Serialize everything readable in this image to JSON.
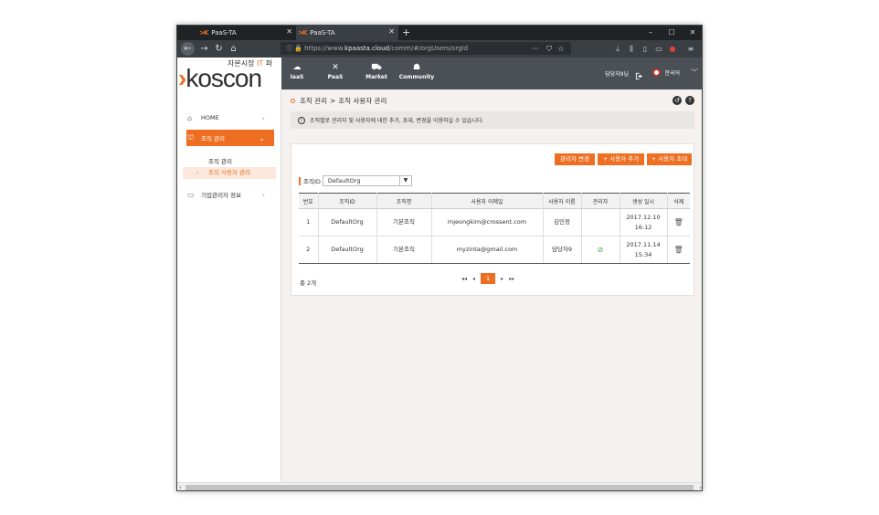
{
  "browser": {
    "tabs": [
      {
        "label": "PaaS-TA",
        "logo": ">K"
      },
      {
        "label": "PaaS-TA",
        "logo": ">K"
      }
    ],
    "new_tab": "+",
    "controls": {
      "minimize": "–",
      "maximize": "☐",
      "close": "✕"
    },
    "url_prefix": "https://www.",
    "url_domain": "kpaasta.cloud",
    "url_path": "/comm/#/orgUsers/orgId",
    "url_more": "···"
  },
  "app": {
    "logo_tagline": "자본시장 ",
    "logo_tagline_it": "IT",
    "logo_tagline_rest": " 파",
    "logo_word": "koscon",
    "logo_chevron": "›",
    "menu": [
      {
        "label": "IaaS",
        "icon": "cloud-icon"
      },
      {
        "label": "PaaS",
        "icon": "tools-icon"
      },
      {
        "label": "Market",
        "icon": "cart-icon"
      },
      {
        "label": "Community",
        "icon": "chat-icon"
      }
    ],
    "user": "담당자9님",
    "language": "한국어"
  },
  "sidebar": {
    "items": [
      {
        "label": "HOME",
        "icon": "home-icon"
      },
      {
        "label": "조직 관리",
        "icon": "org-icon"
      },
      {
        "label": "기업관리자 정보",
        "icon": "card-icon"
      }
    ],
    "subitems": [
      {
        "label": "조직 관리"
      },
      {
        "label": "조직 사용자 관리"
      }
    ]
  },
  "main": {
    "breadcrumb_parent": "조직 관리",
    "breadcrumb_sep": ">",
    "breadcrumb_current": "조직 사용자 관리",
    "notice": "조직별로 관리자 및 사용자에 대한 추가, 초대, 변경을 이용하실 수 있습니다.",
    "buttons": {
      "admin_change": "관리자 변경",
      "add_user": "+ 사용자 추가",
      "invite_user": "+ 사용자 초대"
    },
    "filter_label": "조직ID",
    "filter_value": "DefaultOrg",
    "table": {
      "headers": [
        "번호",
        "조직ID",
        "조직명",
        "사용자 이메일",
        "사용자 이름",
        "관리자",
        "생성 일시",
        "삭제"
      ],
      "rows": [
        {
          "no": "1",
          "org_id": "DefaultOrg",
          "org_name": "기본조직",
          "email": "mjeongkim@crossent.com",
          "name": "김민정",
          "admin": false,
          "date": "2017.12.10",
          "time": "16:12"
        },
        {
          "no": "2",
          "org_id": "DefaultOrg",
          "org_name": "기본조직",
          "email": "myzinta@gmail.com",
          "name": "담당자9",
          "admin": true,
          "date": "2017.11.14",
          "time": "15:34"
        }
      ]
    },
    "total": "총 2개",
    "pager": {
      "first": "◂◂",
      "prev": "◂",
      "current": "1",
      "next": "▸",
      "last": "▸▸"
    }
  }
}
